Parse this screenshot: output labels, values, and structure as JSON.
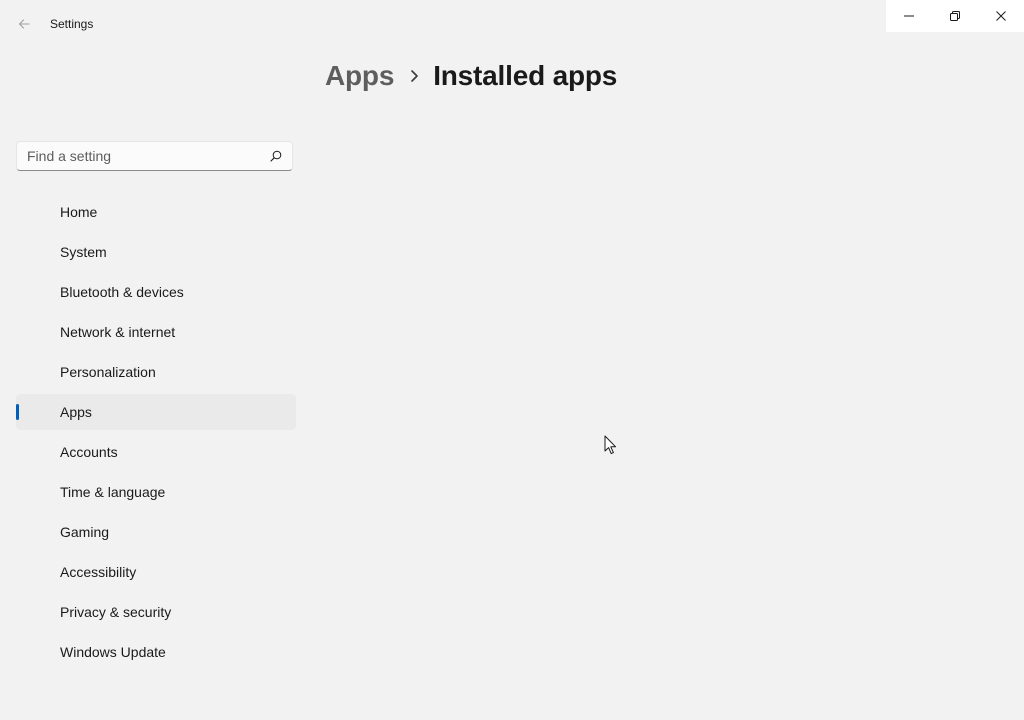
{
  "window": {
    "title": "Settings",
    "back_icon": "arrow-left-icon",
    "minimize_icon": "minimize-icon",
    "restore_icon": "restore-icon",
    "close_icon": "close-icon"
  },
  "breadcrumb": {
    "parent": "Apps",
    "separator_icon": "chevron-right-icon",
    "current": "Installed apps"
  },
  "search": {
    "placeholder": "Find a setting",
    "value": "",
    "icon": "search-icon"
  },
  "sidebar": {
    "items": [
      {
        "label": "Home",
        "selected": false
      },
      {
        "label": "System",
        "selected": false
      },
      {
        "label": "Bluetooth & devices",
        "selected": false
      },
      {
        "label": "Network & internet",
        "selected": false
      },
      {
        "label": "Personalization",
        "selected": false
      },
      {
        "label": "Apps",
        "selected": true
      },
      {
        "label": "Accounts",
        "selected": false
      },
      {
        "label": "Time & language",
        "selected": false
      },
      {
        "label": "Gaming",
        "selected": false
      },
      {
        "label": "Accessibility",
        "selected": false
      },
      {
        "label": "Privacy & security",
        "selected": false
      },
      {
        "label": "Windows Update",
        "selected": false
      }
    ]
  },
  "colors": {
    "background": "#f2f2f2",
    "accent": "#005fb8",
    "selected_item_bg": "#eaeaea",
    "caption_bar_bg": "#ffffff"
  }
}
